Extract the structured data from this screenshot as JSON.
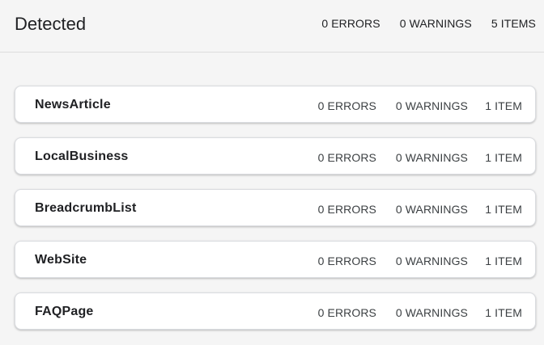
{
  "header": {
    "title": "Detected",
    "errors": "0 ERRORS",
    "warnings": "0 WARNINGS",
    "items": "5 ITEMS"
  },
  "results": [
    {
      "name": "NewsArticle",
      "errors": "0 ERRORS",
      "warnings": "0 WARNINGS",
      "items": "1 ITEM"
    },
    {
      "name": "LocalBusiness",
      "errors": "0 ERRORS",
      "warnings": "0 WARNINGS",
      "items": "1 ITEM"
    },
    {
      "name": "BreadcrumbList",
      "errors": "0 ERRORS",
      "warnings": "0 WARNINGS",
      "items": "1 ITEM"
    },
    {
      "name": "WebSite",
      "errors": "0 ERRORS",
      "warnings": "0 WARNINGS",
      "items": "1 ITEM"
    },
    {
      "name": "FAQPage",
      "errors": "0 ERRORS",
      "warnings": "0 WARNINGS",
      "items": "1 ITEM"
    }
  ]
}
